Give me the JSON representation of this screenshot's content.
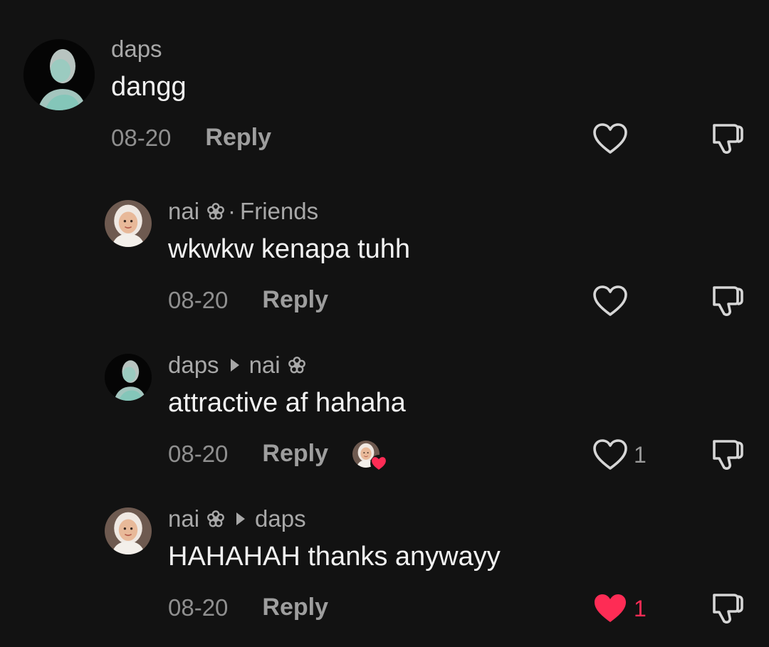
{
  "comments": [
    {
      "author": "daps",
      "text": "dangg",
      "date": "08-20",
      "reply_label": "Reply",
      "like_count": "",
      "liked": false
    },
    {
      "author": "nai",
      "relation": "Friends",
      "text": "wkwkw kenapa tuhh",
      "date": "08-20",
      "reply_label": "Reply",
      "like_count": "",
      "liked": false
    },
    {
      "author": "daps",
      "reply_to": "nai",
      "text": "attractive af hahaha",
      "date": "08-20",
      "reply_label": "Reply",
      "like_count": "1",
      "liked": false,
      "liked_by_creator": true
    },
    {
      "author": "nai",
      "reply_to": "daps",
      "text": "HAHAHAH thanks anywayy",
      "date": "08-20",
      "reply_label": "Reply",
      "like_count": "1",
      "liked": true
    }
  ],
  "colors": {
    "background": "#121212",
    "heart_active": "#fe2c55",
    "secondary_text": "#a8a8a8"
  },
  "icons": {
    "like": "heart-outline-icon",
    "liked": "heart-filled-icon",
    "dislike": "thumbs-down-icon",
    "flower": "flower-icon",
    "reply_arrow": "triangle-right-icon"
  }
}
